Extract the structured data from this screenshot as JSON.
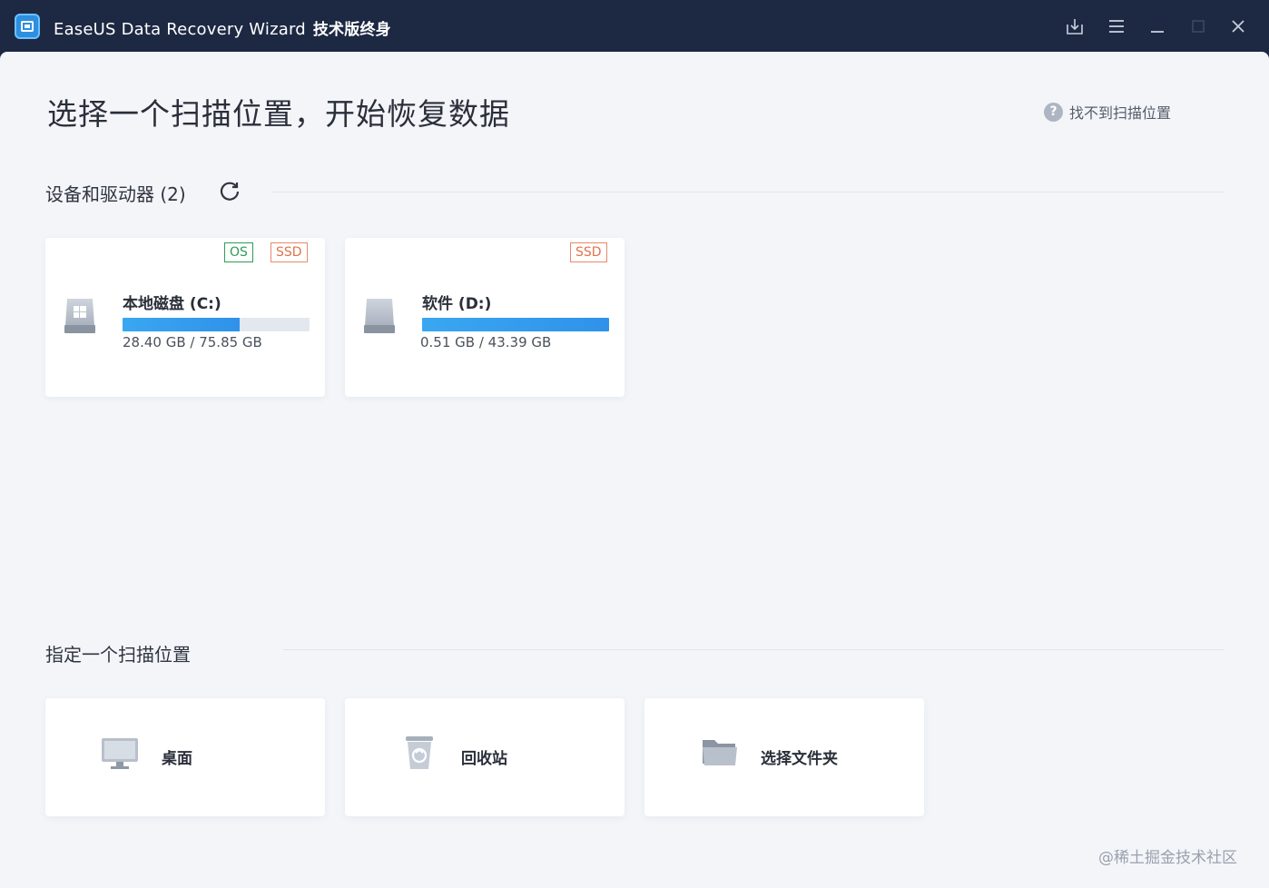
{
  "window": {
    "title": "EaseUS Data Recovery Wizard",
    "edition": "技术版终身"
  },
  "header": {
    "page_title": "选择一个扫描位置，开始恢复数据",
    "help_link": "找不到扫描位置",
    "help_icon_glyph": "?"
  },
  "devices": {
    "heading": "设备和驱动器 (2)",
    "drives": [
      {
        "name": "本地磁盘 (C:)",
        "tags": [
          "OS",
          "SSD"
        ],
        "size_text": "28.40 GB / 75.85 GB",
        "used_fraction": 0.624,
        "icon": "windows-drive-icon"
      },
      {
        "name": "软件 (D:)",
        "tags": [
          "SSD"
        ],
        "size_text": "0.51 GB / 43.39 GB",
        "used_fraction": 1.0,
        "icon": "hard-drive-icon"
      }
    ]
  },
  "locations": {
    "heading": "指定一个扫描位置",
    "items": [
      {
        "label": "桌面",
        "icon": "desktop-monitor-icon"
      },
      {
        "label": "回收站",
        "icon": "recycle-bin-icon"
      },
      {
        "label": "选择文件夹",
        "icon": "folder-icon"
      }
    ]
  },
  "watermark": "@稀土掘金技术社区",
  "colors": {
    "titlebar": "#1d2943",
    "content_bg": "#f3f5f9",
    "progress_fill": "#2f92ea",
    "os_tag": "#2e9b57",
    "ssd_tag": "#e2734a"
  }
}
